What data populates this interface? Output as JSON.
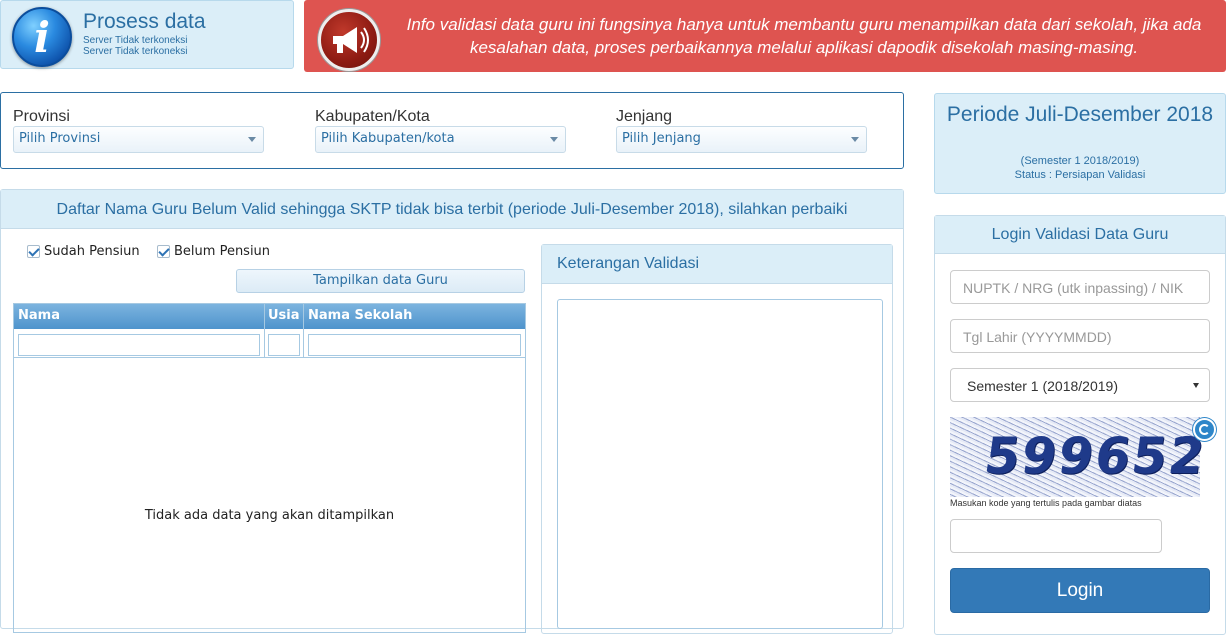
{
  "header": {
    "title": "Prosess data",
    "status_lines": [
      "Server Tidak terkoneksi",
      "Server Tidak terkoneksi"
    ],
    "alert_text": "Info validasi data guru ini fungsinya hanya untuk membantu guru menampilkan data dari sekolah, jika ada kesalahan data, proses perbaikannya melalui aplikasi dapodik disekolah masing-masing."
  },
  "filters": {
    "provinsi": {
      "label": "Provinsi",
      "value": "Pilih Provinsi"
    },
    "kabupaten": {
      "label": "Kabupaten/Kota",
      "value": "Pilih Kabupaten/kota"
    },
    "jenjang": {
      "label": "Jenjang",
      "value": "Pilih Jenjang"
    }
  },
  "daftar": {
    "title": "Daftar Nama Guru Belum Valid sehingga SKTP tidak bisa terbit (periode Juli-Desember 2018), silahkan perbaiki",
    "checkbox_sudah": {
      "label": "Sudah Pensiun",
      "checked": true
    },
    "checkbox_belum": {
      "label": "Belum Pensiun",
      "checked": true
    },
    "button_label": "Tampilkan data Guru",
    "columns": [
      "Nama",
      "Usia",
      "Nama Sekolah"
    ],
    "empty_text": "Tidak ada data yang akan ditampilkan"
  },
  "keterangan": {
    "title": "Keterangan Validasi"
  },
  "periode": {
    "title": "Periode Juli-Desember 2018",
    "semester": "(Semester 1 2018/2019)",
    "status": "Status : Persiapan Validasi"
  },
  "login": {
    "title": "Login Validasi Data Guru",
    "nuptk_placeholder": "NUPTK / NRG (utk inpassing) / NIK",
    "tgl_placeholder": "Tgl Lahir (YYYYMMDD)",
    "semester_value": "Semester 1 (2018/2019)",
    "captcha_code": "599652",
    "captcha_hint": "Masukan kode yang tertulis pada gambar diatas",
    "button_label": "Login"
  }
}
